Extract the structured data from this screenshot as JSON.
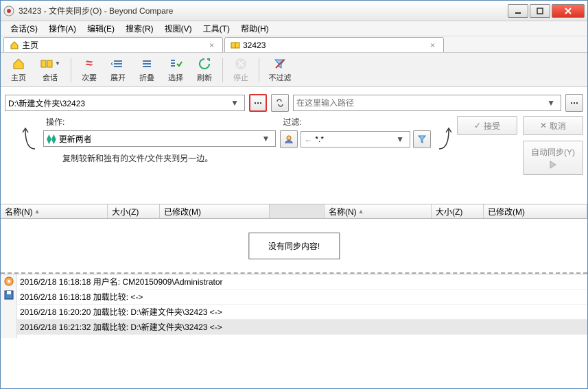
{
  "window": {
    "title": "32423 - 文件夹同步(O) - Beyond Compare"
  },
  "menu": {
    "session": "会话(S)",
    "action": "操作(A)",
    "edit": "编辑(E)",
    "search": "搜索(R)",
    "view": "视图(V)",
    "tools": "工具(T)",
    "help": "帮助(H)"
  },
  "tabs": {
    "home": "主页",
    "current": "32423"
  },
  "toolbar": {
    "home": "主页",
    "session": "会话",
    "secondary": "次要",
    "expand": "展开",
    "collapse": "折叠",
    "select": "选择",
    "refresh": "刷新",
    "stop": "停止",
    "nofilter": "不过滤"
  },
  "paths": {
    "left": "D:\\新建文件夹\\32423",
    "right_placeholder": "在这里输入路径"
  },
  "op": {
    "label": "操作:",
    "value": "更新两者",
    "hint": "复制较新和独有的文件/文件夹到另一边。"
  },
  "filter": {
    "label": "过滤:",
    "value": "*.*"
  },
  "buttons": {
    "accept": "接受",
    "cancel": "取消",
    "autosync": "自动同步(Y)"
  },
  "headers": {
    "name": "名称(N)",
    "size": "大小(Z)",
    "modified": "已修改(M)"
  },
  "nosync": "没有同步内容!",
  "log": [
    "2016/2/18 16:18:18  用户名: CM20150909\\Administrator",
    "2016/2/18 16:18:18  加载比较:  <->",
    "2016/2/18 16:20:20  加载比较: D:\\新建文件夹\\32423 <->",
    "2016/2/18 16:21:32  加载比较: D:\\新建文件夹\\32423 <->"
  ],
  "glyphs": {
    "check": "✓",
    "x": "✕"
  }
}
